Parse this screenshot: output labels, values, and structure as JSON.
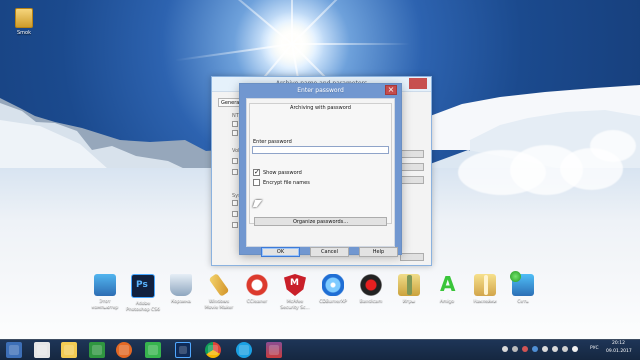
{
  "desktop": {
    "top_icon_label": "Smok",
    "icons": [
      {
        "label": "Этот компьютер",
        "name": "this-pc"
      },
      {
        "label": "Adobe Photoshop CS6",
        "name": "photoshop"
      },
      {
        "label": "Корзина",
        "name": "recycle-bin"
      },
      {
        "label": "Windows Movie Maker",
        "name": "movie-maker"
      },
      {
        "label": "CCleaner",
        "name": "ccleaner"
      },
      {
        "label": "McAfee Security Sc...",
        "name": "mcafee"
      },
      {
        "label": "CDBurnerXP",
        "name": "cdburnerxp"
      },
      {
        "label": "Bandicam",
        "name": "bandicam"
      },
      {
        "label": "Игры",
        "name": "games"
      },
      {
        "label": "Amigo",
        "name": "amigo"
      },
      {
        "label": "Наклейки",
        "name": "stickers"
      },
      {
        "label": "Сеть",
        "name": "network"
      }
    ]
  },
  "archive_window": {
    "title": "Archive name and parameters",
    "tab": "General",
    "side_labels": [
      "NTF",
      "Volu",
      "Syst"
    ]
  },
  "password_dialog": {
    "title": "Enter password",
    "heading": "Archiving with password",
    "input_label": "Enter password",
    "password_value": "",
    "show_password_label": "Show password",
    "show_password_checked": true,
    "encrypt_file_names_label": "Encrypt file names",
    "encrypt_file_names_checked": false,
    "organize_button_label": "Organize passwords...",
    "ok_label": "OK",
    "cancel_label": "Cancel",
    "help_label": "Help"
  },
  "taskbar": {
    "language": "РУС",
    "time": "20:12",
    "date": "09.01.2017"
  },
  "colors": {
    "dialog_frame": "#7197d0",
    "taskbar": "#1d2f4b",
    "desktop_sky": "#2d63b0"
  }
}
